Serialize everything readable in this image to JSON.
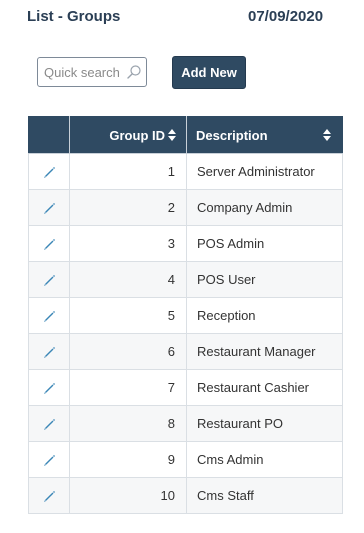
{
  "header": {
    "title": "List - Groups",
    "date": "07/09/2020"
  },
  "toolbar": {
    "search_placeholder": "Quick search",
    "search_value": "",
    "add_new_label": "Add New"
  },
  "table": {
    "columns": {
      "edit": "",
      "group_id": "Group ID",
      "description": "Description"
    },
    "rows": [
      {
        "group_id": "1",
        "description": "Server Administrator"
      },
      {
        "group_id": "2",
        "description": "Company Admin"
      },
      {
        "group_id": "3",
        "description": "POS Admin"
      },
      {
        "group_id": "4",
        "description": "POS User"
      },
      {
        "group_id": "5",
        "description": "Reception"
      },
      {
        "group_id": "6",
        "description": "Restaurant Manager"
      },
      {
        "group_id": "7",
        "description": "Restaurant Cashier"
      },
      {
        "group_id": "8",
        "description": "Restaurant PO"
      },
      {
        "group_id": "9",
        "description": "Cms Admin"
      },
      {
        "group_id": "10",
        "description": "Cms Staff"
      }
    ]
  },
  "icons": {
    "search": "search-icon",
    "sort": "sort-icon",
    "edit": "pencil-icon"
  },
  "colors": {
    "header_bg": "#2f4a62",
    "title_text": "#2b3f55",
    "edit_icon": "#3a86b6"
  }
}
